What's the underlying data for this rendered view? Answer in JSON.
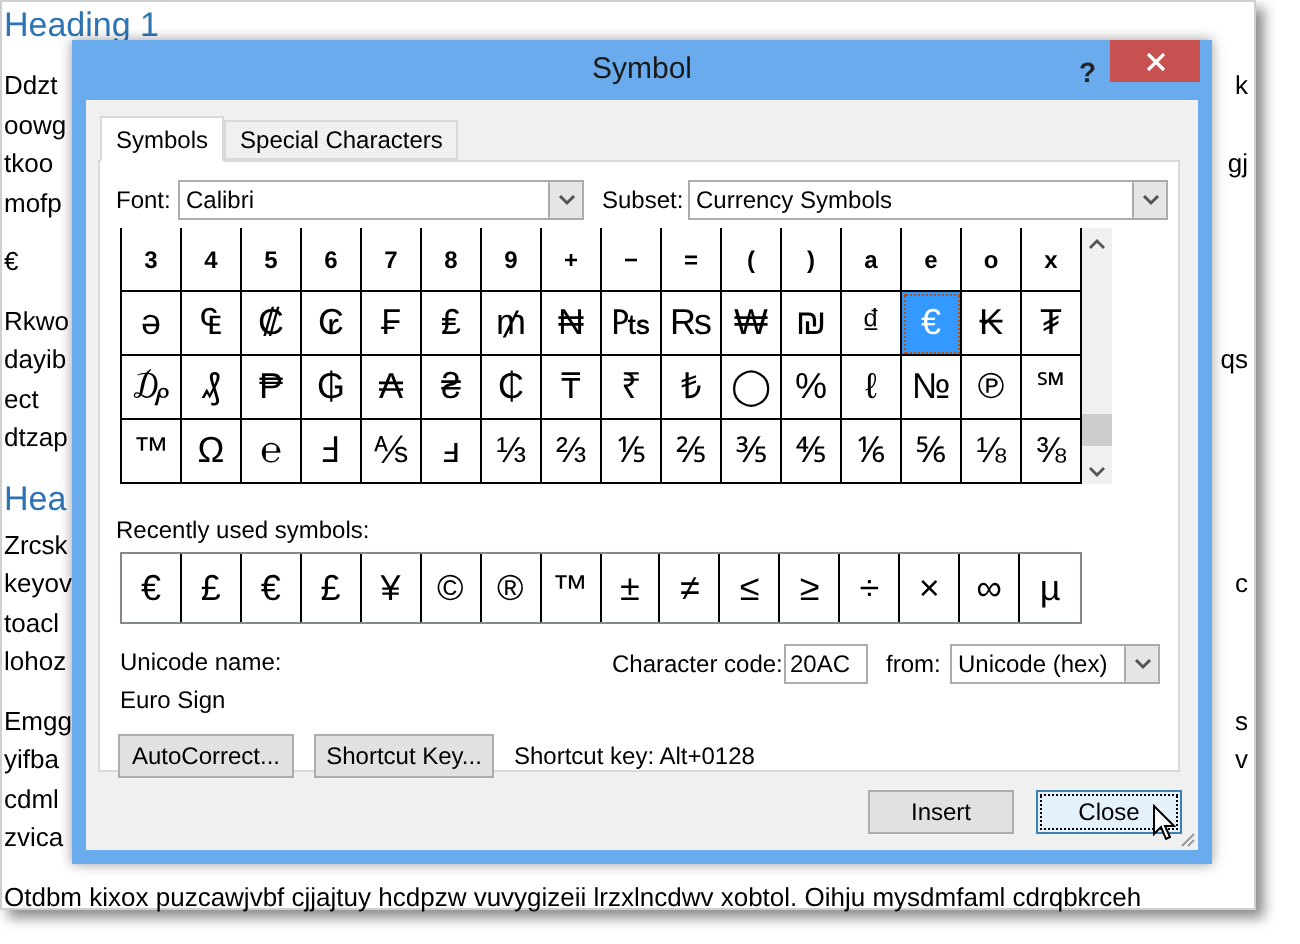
{
  "document": {
    "blocks": [
      {
        "kind": "heading",
        "text": "Heading 1"
      },
      {
        "kind": "paragraph",
        "lines": [
          {
            "left": "Ddzt",
            "right": "k"
          },
          {
            "left": "oowg"
          },
          {
            "left": "tkoo",
            "right": "gj"
          },
          {
            "left": "mofp"
          }
        ]
      },
      {
        "kind": "paragraph",
        "lines": [
          {
            "left": "€"
          }
        ]
      },
      {
        "kind": "paragraph",
        "lines": [
          {
            "left": "Rkwo"
          },
          {
            "left": "dayib",
            "right": "qs"
          },
          {
            "left": "ect"
          },
          {
            "left": "dtzap"
          }
        ]
      },
      {
        "kind": "heading",
        "text": "Hea"
      },
      {
        "kind": "paragraph",
        "lines": [
          {
            "left": "Zrcsk"
          },
          {
            "left": "keyov",
            "right": "c"
          },
          {
            "left": "toacl"
          },
          {
            "left": "lohoz"
          }
        ]
      },
      {
        "kind": "paragraph",
        "lines": [
          {
            "left": "Emgg",
            "right": "s"
          },
          {
            "left": "yifba",
            "right": "v"
          },
          {
            "left": "cdml"
          },
          {
            "left": "zvica"
          }
        ]
      },
      {
        "kind": "paragraph",
        "lines": [
          {
            "left": "Otdbm kixox puzcawjvbf cjjajtuy hcdpzw vuvygizeii lrzxlncdwv xobtol. Oihju mysdmfaml cdrqbkrceh"
          }
        ]
      }
    ]
  },
  "dialog": {
    "title": "Symbol",
    "help": "?",
    "tabs": [
      {
        "label": "Symbols",
        "selected": true
      },
      {
        "label": "Special Characters",
        "selected": false
      }
    ],
    "font": {
      "label": "Font:",
      "value": "Calibri"
    },
    "subset": {
      "label": "Subset:",
      "value": "Currency Symbols"
    },
    "symbol_grid": [
      [
        {
          "char": "3",
          "selected": false
        },
        {
          "char": "4",
          "selected": false
        },
        {
          "char": "5",
          "selected": false
        },
        {
          "char": "6",
          "selected": false
        },
        {
          "char": "7",
          "selected": false
        },
        {
          "char": "8",
          "selected": false
        },
        {
          "char": "9",
          "selected": false
        },
        {
          "char": "+",
          "selected": false
        },
        {
          "char": "−",
          "selected": false
        },
        {
          "char": "=",
          "selected": false
        },
        {
          "char": "(",
          "selected": false
        },
        {
          "char": ")",
          "selected": false
        },
        {
          "char": "a",
          "selected": false
        },
        {
          "char": "e",
          "selected": false
        },
        {
          "char": "o",
          "selected": false
        },
        {
          "char": "x",
          "selected": false
        }
      ],
      [
        {
          "char": "ə",
          "selected": false
        },
        {
          "char": "₠",
          "selected": false
        },
        {
          "char": "₡",
          "selected": false
        },
        {
          "char": "₢",
          "selected": false
        },
        {
          "char": "₣",
          "selected": false
        },
        {
          "char": "₤",
          "selected": false
        },
        {
          "char": "₥",
          "selected": false
        },
        {
          "char": "₦",
          "selected": false
        },
        {
          "char": "₧",
          "selected": false
        },
        {
          "char": "₨",
          "selected": false
        },
        {
          "char": "₩",
          "selected": false
        },
        {
          "char": "₪",
          "selected": false
        },
        {
          "char": "₫",
          "selected": false
        },
        {
          "char": "€",
          "selected": true
        },
        {
          "char": "₭",
          "selected": false
        },
        {
          "char": "₮",
          "selected": false
        }
      ],
      [
        {
          "char": "₯",
          "selected": false
        },
        {
          "char": "₰",
          "selected": false
        },
        {
          "char": "₱",
          "selected": false
        },
        {
          "char": "₲",
          "selected": false
        },
        {
          "char": "₳",
          "selected": false
        },
        {
          "char": "₴",
          "selected": false
        },
        {
          "char": "₵",
          "selected": false
        },
        {
          "char": "₸",
          "selected": false
        },
        {
          "char": "₹",
          "selected": false
        },
        {
          "char": "₺",
          "selected": false
        },
        {
          "char": "◯",
          "selected": false
        },
        {
          "char": "%",
          "selected": false
        },
        {
          "char": "ℓ",
          "selected": false
        },
        {
          "char": "№",
          "selected": false
        },
        {
          "char": "℗",
          "selected": false
        },
        {
          "char": "℠",
          "selected": false
        }
      ],
      [
        {
          "char": "™",
          "selected": false
        },
        {
          "char": "Ω",
          "selected": false
        },
        {
          "char": "℮",
          "selected": false
        },
        {
          "char": "Ⅎ",
          "selected": false
        },
        {
          "char": "⅍",
          "selected": false
        },
        {
          "char": "ⅎ",
          "selected": false
        },
        {
          "char": "⅓",
          "selected": false
        },
        {
          "char": "⅔",
          "selected": false
        },
        {
          "char": "⅕",
          "selected": false
        },
        {
          "char": "⅖",
          "selected": false
        },
        {
          "char": "⅗",
          "selected": false
        },
        {
          "char": "⅘",
          "selected": false
        },
        {
          "char": "⅙",
          "selected": false
        },
        {
          "char": "⅚",
          "selected": false
        },
        {
          "char": "⅛",
          "selected": false
        },
        {
          "char": "⅜",
          "selected": false
        }
      ]
    ],
    "recent_label": "Recently used symbols:",
    "recent": [
      "€",
      "£",
      "€",
      "£",
      "¥",
      "©",
      "®",
      "™",
      "±",
      "≠",
      "≤",
      "≥",
      "÷",
      "×",
      "∞",
      "µ"
    ],
    "unicode_name_label": "Unicode name:",
    "unicode_name": "Euro Sign",
    "character_code": {
      "label": "Character code:",
      "value": "20AC"
    },
    "from": {
      "label": "from:",
      "value": "Unicode (hex)"
    },
    "autocorrect_button": "AutoCorrect...",
    "shortcut_key_button": "Shortcut Key...",
    "shortcut_key_text": "Shortcut key: Alt+0128",
    "buttons": [
      "Insert",
      "Close"
    ]
  }
}
